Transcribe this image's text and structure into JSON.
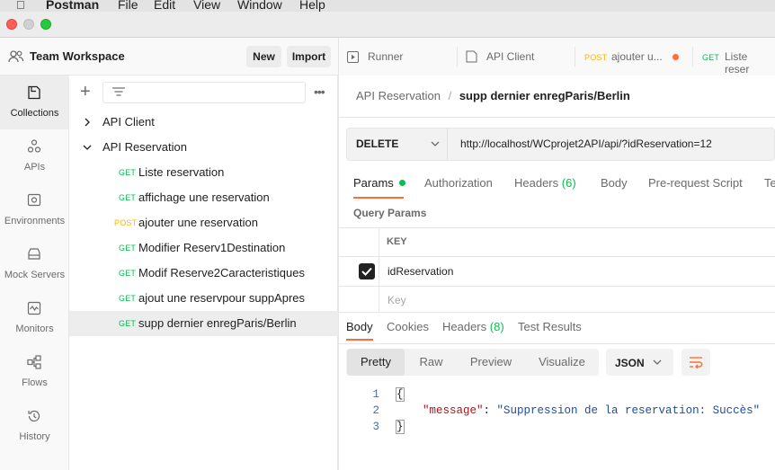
{
  "menubar": {
    "app": "Postman",
    "file": "File",
    "edit": "Edit",
    "view": "View",
    "window": "Window",
    "help": "Help"
  },
  "workspace": {
    "name": "Team Workspace",
    "new_label": "New",
    "import_label": "Import"
  },
  "rail": [
    {
      "label": "Collections",
      "icon": "collections-icon"
    },
    {
      "label": "APIs",
      "icon": "apis-icon"
    },
    {
      "label": "Environments",
      "icon": "environments-icon"
    },
    {
      "label": "Mock Servers",
      "icon": "mock-servers-icon"
    },
    {
      "label": "Monitors",
      "icon": "monitors-icon"
    },
    {
      "label": "Flows",
      "icon": "flows-icon"
    },
    {
      "label": "History",
      "icon": "history-icon"
    }
  ],
  "tree": {
    "collections": [
      {
        "name": "API Client",
        "expanded": false
      },
      {
        "name": "API Reservation",
        "expanded": true
      }
    ],
    "requests": [
      {
        "method": "GET",
        "name": "Liste reservation"
      },
      {
        "method": "GET",
        "name": "affichage une reservation"
      },
      {
        "method": "POST",
        "name": "ajouter une reservation"
      },
      {
        "method": "GET",
        "name": "Modifier Reserv1Destination"
      },
      {
        "method": "GET",
        "name": "Modif Reserve2Caracteristiques"
      },
      {
        "method": "GET",
        "name": "ajout une reservpour suppApres"
      },
      {
        "method": "GET",
        "name": "supp dernier enregParis/Berlin"
      }
    ]
  },
  "tabs": {
    "runner": "Runner",
    "api_client": "API Client",
    "post_method": "POST",
    "post_name": "ajouter u...",
    "get_method": "GET",
    "get_name": "Liste reser"
  },
  "breadcrumb": {
    "collection": "API Reservation",
    "separator": "/",
    "request": "supp dernier enregParis/Berlin"
  },
  "request": {
    "method": "DELETE",
    "url": "http://localhost/WCprojet2API/api/?idReservation=12"
  },
  "request_tabs": {
    "params": "Params",
    "authorization": "Authorization",
    "headers": "Headers",
    "headers_count": "(6)",
    "body": "Body",
    "pre_request": "Pre-request Script",
    "tests": "Te"
  },
  "query_params": {
    "title": "Query Params",
    "key_header": "KEY",
    "rows": [
      {
        "key": "idReservation",
        "checked": true
      }
    ],
    "key_placeholder": "Key"
  },
  "response_tabs": {
    "body": "Body",
    "cookies": "Cookies",
    "headers": "Headers",
    "headers_count": "(8)",
    "test_results": "Test Results"
  },
  "view_modes": {
    "pretty": "Pretty",
    "raw": "Raw",
    "preview": "Preview",
    "visualize": "Visualize",
    "format": "JSON"
  },
  "response": {
    "line_numbers": [
      "1",
      "2",
      "3"
    ],
    "open_brace": "{",
    "key": "\"message\"",
    "colon": ": ",
    "value": "\"Suppression de la reservation: Succès\"",
    "close_brace": "}"
  },
  "colors": {
    "accent": "#ff6c37",
    "get": "#0cbb52",
    "post": "#ffb400",
    "json_key": "#a3171a",
    "json_string": "#1c4ea1"
  }
}
